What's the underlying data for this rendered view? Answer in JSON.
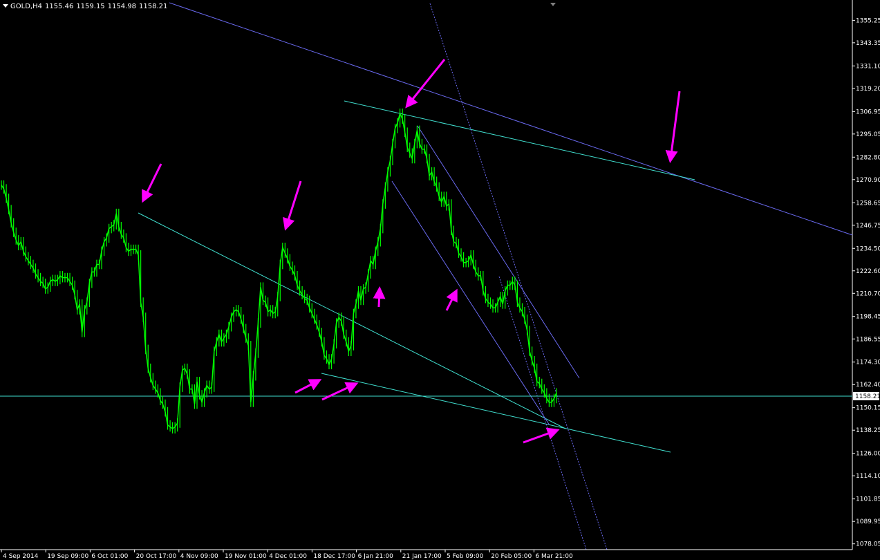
{
  "header": {
    "symbol": "GOLD,H4",
    "open": "1155.46",
    "high": "1159.15",
    "low": "1154.98",
    "close": "1158.21"
  },
  "colors": {
    "background": "#000000",
    "candles": "#00ff00",
    "channel": "#40e0d0",
    "trendline": "#6a6af0",
    "arrows": "#ff00ff",
    "axis_text": "#ffffff",
    "current_price_box": "#ffffff"
  },
  "chart_data": {
    "type": "line",
    "title": "",
    "ylim": [
      1075,
      1366
    ],
    "y_ticks": [
      "1355.25",
      "1343.35",
      "1331.10",
      "1319.20",
      "1306.95",
      "1295.05",
      "1282.80",
      "1270.90",
      "1258.65",
      "1246.75",
      "1234.50",
      "1222.60",
      "1210.70",
      "1198.45",
      "1186.55",
      "1174.30",
      "1162.40",
      "1150.15",
      "1138.25",
      "1126.00",
      "1114.10",
      "1101.85",
      "1089.95",
      "1078.05"
    ],
    "x_ticks": [
      "4 Sep 2014",
      "19 Sep 09:00",
      "6 Oct 01:00",
      "20 Oct 17:00",
      "4 Nov 09:00",
      "19 Nov 01:00",
      "4 Dec 01:00",
      "18 Dec 17:00",
      "6 Jan 21:00",
      "21 Jan 17:00",
      "5 Feb 09:00",
      "20 Feb 05:00",
      "6 Mar 21:00"
    ],
    "current_price": "1158.21",
    "series": [
      {
        "values": [
          1268,
          1266,
          1261,
          1255,
          1248,
          1243,
          1239,
          1236,
          1238,
          1233,
          1230,
          1228,
          1226,
          1224,
          1221,
          1219,
          1217,
          1216,
          1213,
          1214,
          1217,
          1218,
          1217,
          1218,
          1220,
          1219,
          1219,
          1219,
          1217,
          1215,
          1210,
          1202,
          1205,
          1190,
          1202,
          1206,
          1216,
          1222,
          1222,
          1226,
          1226,
          1233,
          1238,
          1240,
          1245,
          1246,
          1247,
          1253,
          1246,
          1242,
          1240,
          1235,
          1233,
          1234,
          1234,
          1234,
          1231,
          1206,
          1198,
          1181,
          1171,
          1166,
          1162,
          1160,
          1158,
          1154,
          1152,
          1148,
          1141,
          1140,
          1139,
          1140,
          1142,
          1161,
          1170,
          1171,
          1168,
          1160,
          1160,
          1152,
          1164,
          1157,
          1153,
          1158,
          1162,
          1160,
          1161,
          1180,
          1185,
          1189,
          1185,
          1187,
          1189,
          1193,
          1198,
          1201,
          1202,
          1201,
          1197,
          1192,
          1187,
          1183,
          1153,
          1167,
          1179,
          1195,
          1214,
          1207,
          1206,
          1201,
          1202,
          1200,
          1201,
          1209,
          1226,
          1235,
          1232,
          1229,
          1225,
          1223,
          1220,
          1215,
          1212,
          1210,
          1208,
          1207,
          1203,
          1200,
          1197,
          1194,
          1190,
          1185,
          1178,
          1176,
          1173,
          1176,
          1184,
          1195,
          1198,
          1196,
          1189,
          1185,
          1180,
          1183,
          1200,
          1205,
          1212,
          1207,
          1213,
          1214,
          1221,
          1228,
          1226,
          1233,
          1238,
          1245,
          1258,
          1267,
          1275,
          1281,
          1290,
          1298,
          1301,
          1306,
          1303,
          1296,
          1288,
          1285,
          1282,
          1290,
          1297,
          1290,
          1287,
          1287,
          1282,
          1273,
          1275,
          1270,
          1267,
          1262,
          1259,
          1262,
          1257,
          1258,
          1244,
          1238,
          1237,
          1232,
          1230,
          1227,
          1227,
          1228,
          1231,
          1226,
          1222,
          1220,
          1220,
          1212,
          1208,
          1206,
          1205,
          1203,
          1203,
          1206,
          1209,
          1205,
          1212,
          1215,
          1215,
          1217,
          1215,
          1206,
          1203,
          1201,
          1197,
          1191,
          1180,
          1175,
          1171,
          1164,
          1163,
          1160,
          1158,
          1155,
          1153,
          1153,
          1155,
          1158
        ]
      }
    ]
  }
}
